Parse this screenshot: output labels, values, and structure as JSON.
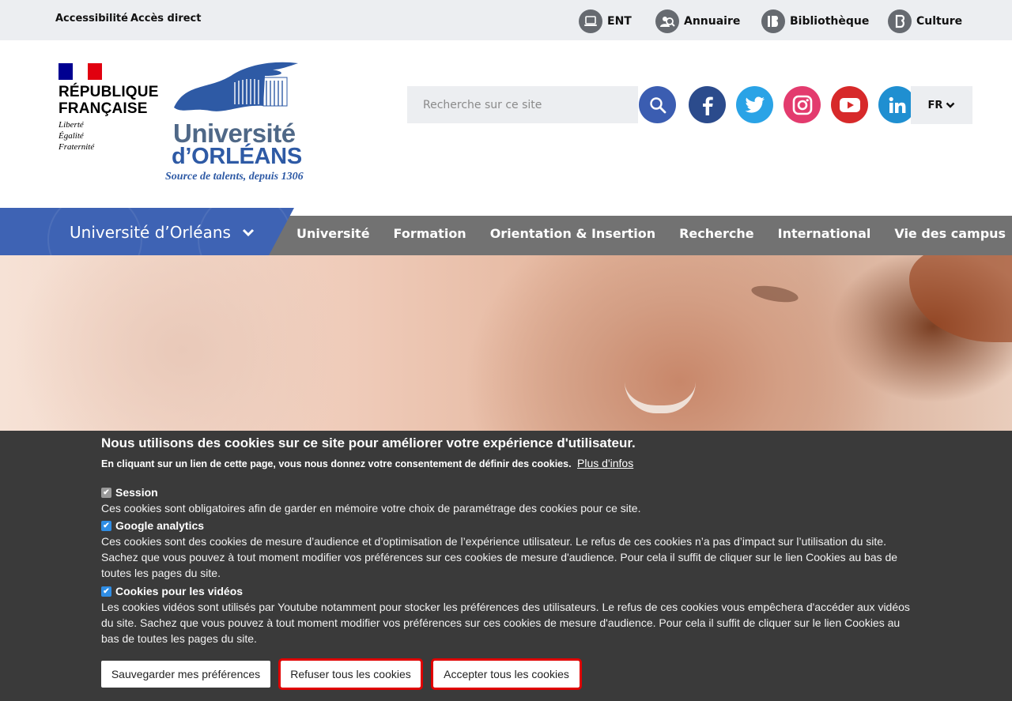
{
  "topbar": {
    "accessibility": "Accessibilité",
    "direct_access": "Accès direct",
    "links": [
      {
        "label": "ENT",
        "icon": "laptop-icon"
      },
      {
        "label": "Annuaire",
        "icon": "people-search-icon"
      },
      {
        "label": "Bibliothèque",
        "icon": "library-icon"
      },
      {
        "label": "Culture",
        "icon": "culture-icon"
      }
    ]
  },
  "header": {
    "rf_name_line1": "RÉPUBLIQUE",
    "rf_name_line2": "FRANÇAISE",
    "rf_motto1": "Liberté",
    "rf_motto2": "Égalité",
    "rf_motto3": "Fraternité",
    "uni_line1": "Université",
    "uni_line2": "d’ORLÉANS",
    "tagline": "Source de talents, depuis 1306",
    "search_placeholder": "Recherche sur ce site",
    "social": [
      "facebook-icon",
      "twitter-icon",
      "instagram-icon",
      "youtube-icon",
      "linkedin-icon"
    ],
    "lang": "FR"
  },
  "nav": {
    "site_title": "Université d’Orléans",
    "items": [
      "Université",
      "Formation",
      "Orientation & Insertion",
      "Recherche",
      "International",
      "Vie des campus"
    ]
  },
  "cookie": {
    "title": "Nous utilisons des cookies sur ce site pour améliorer votre expérience d'utilisateur.",
    "subtitle": "En cliquant sur un lien de cette page, vous nous donnez votre consentement de définir des cookies.",
    "more_info": "Plus d'infos",
    "options": [
      {
        "label": "Session",
        "checked": true,
        "disabled": true,
        "desc": "Ces cookies sont obligatoires afin de garder en mémoire votre choix de paramétrage des cookies pour ce site."
      },
      {
        "label": "Google analytics",
        "checked": true,
        "disabled": false,
        "desc": "Ces cookies sont des cookies de mesure d’audience et d’optimisation de l’expérience utilisateur. Le refus de ces cookies n’a pas d’impact sur l’utilisation du site. Sachez que vous pouvez à tout moment modifier vos préférences sur ces cookies de mesure d'audience. Pour cela il suffit de cliquer sur le lien Cookies au bas de toutes les pages du site."
      },
      {
        "label": "Cookies pour les vidéos",
        "checked": true,
        "disabled": false,
        "desc": "Les cookies vidéos sont utilisés par Youtube notamment pour stocker les préférences des utilisateurs. Le refus de ces cookies vous empêchera d'accéder aux vidéos du site. Sachez que vous pouvez à tout moment modifier vos préférences sur ces cookies de mesure d'audience. Pour cela il suffit de cliquer sur le lien Cookies au bas de toutes les pages du site."
      }
    ],
    "buttons": {
      "save": "Sauvegarder mes préférences",
      "refuse": "Refuser tous les cookies",
      "accept": "Accepter tous les cookies"
    }
  },
  "colors": {
    "brand_blue": "#3e63b4",
    "nav_gray": "#727272",
    "facebook": "#2b4b8c",
    "twitter": "#2aa3e6",
    "instagram": "#e33b6e",
    "youtube": "#d7292a",
    "linkedin": "#1f8fd1",
    "highlight": "#e00000"
  }
}
